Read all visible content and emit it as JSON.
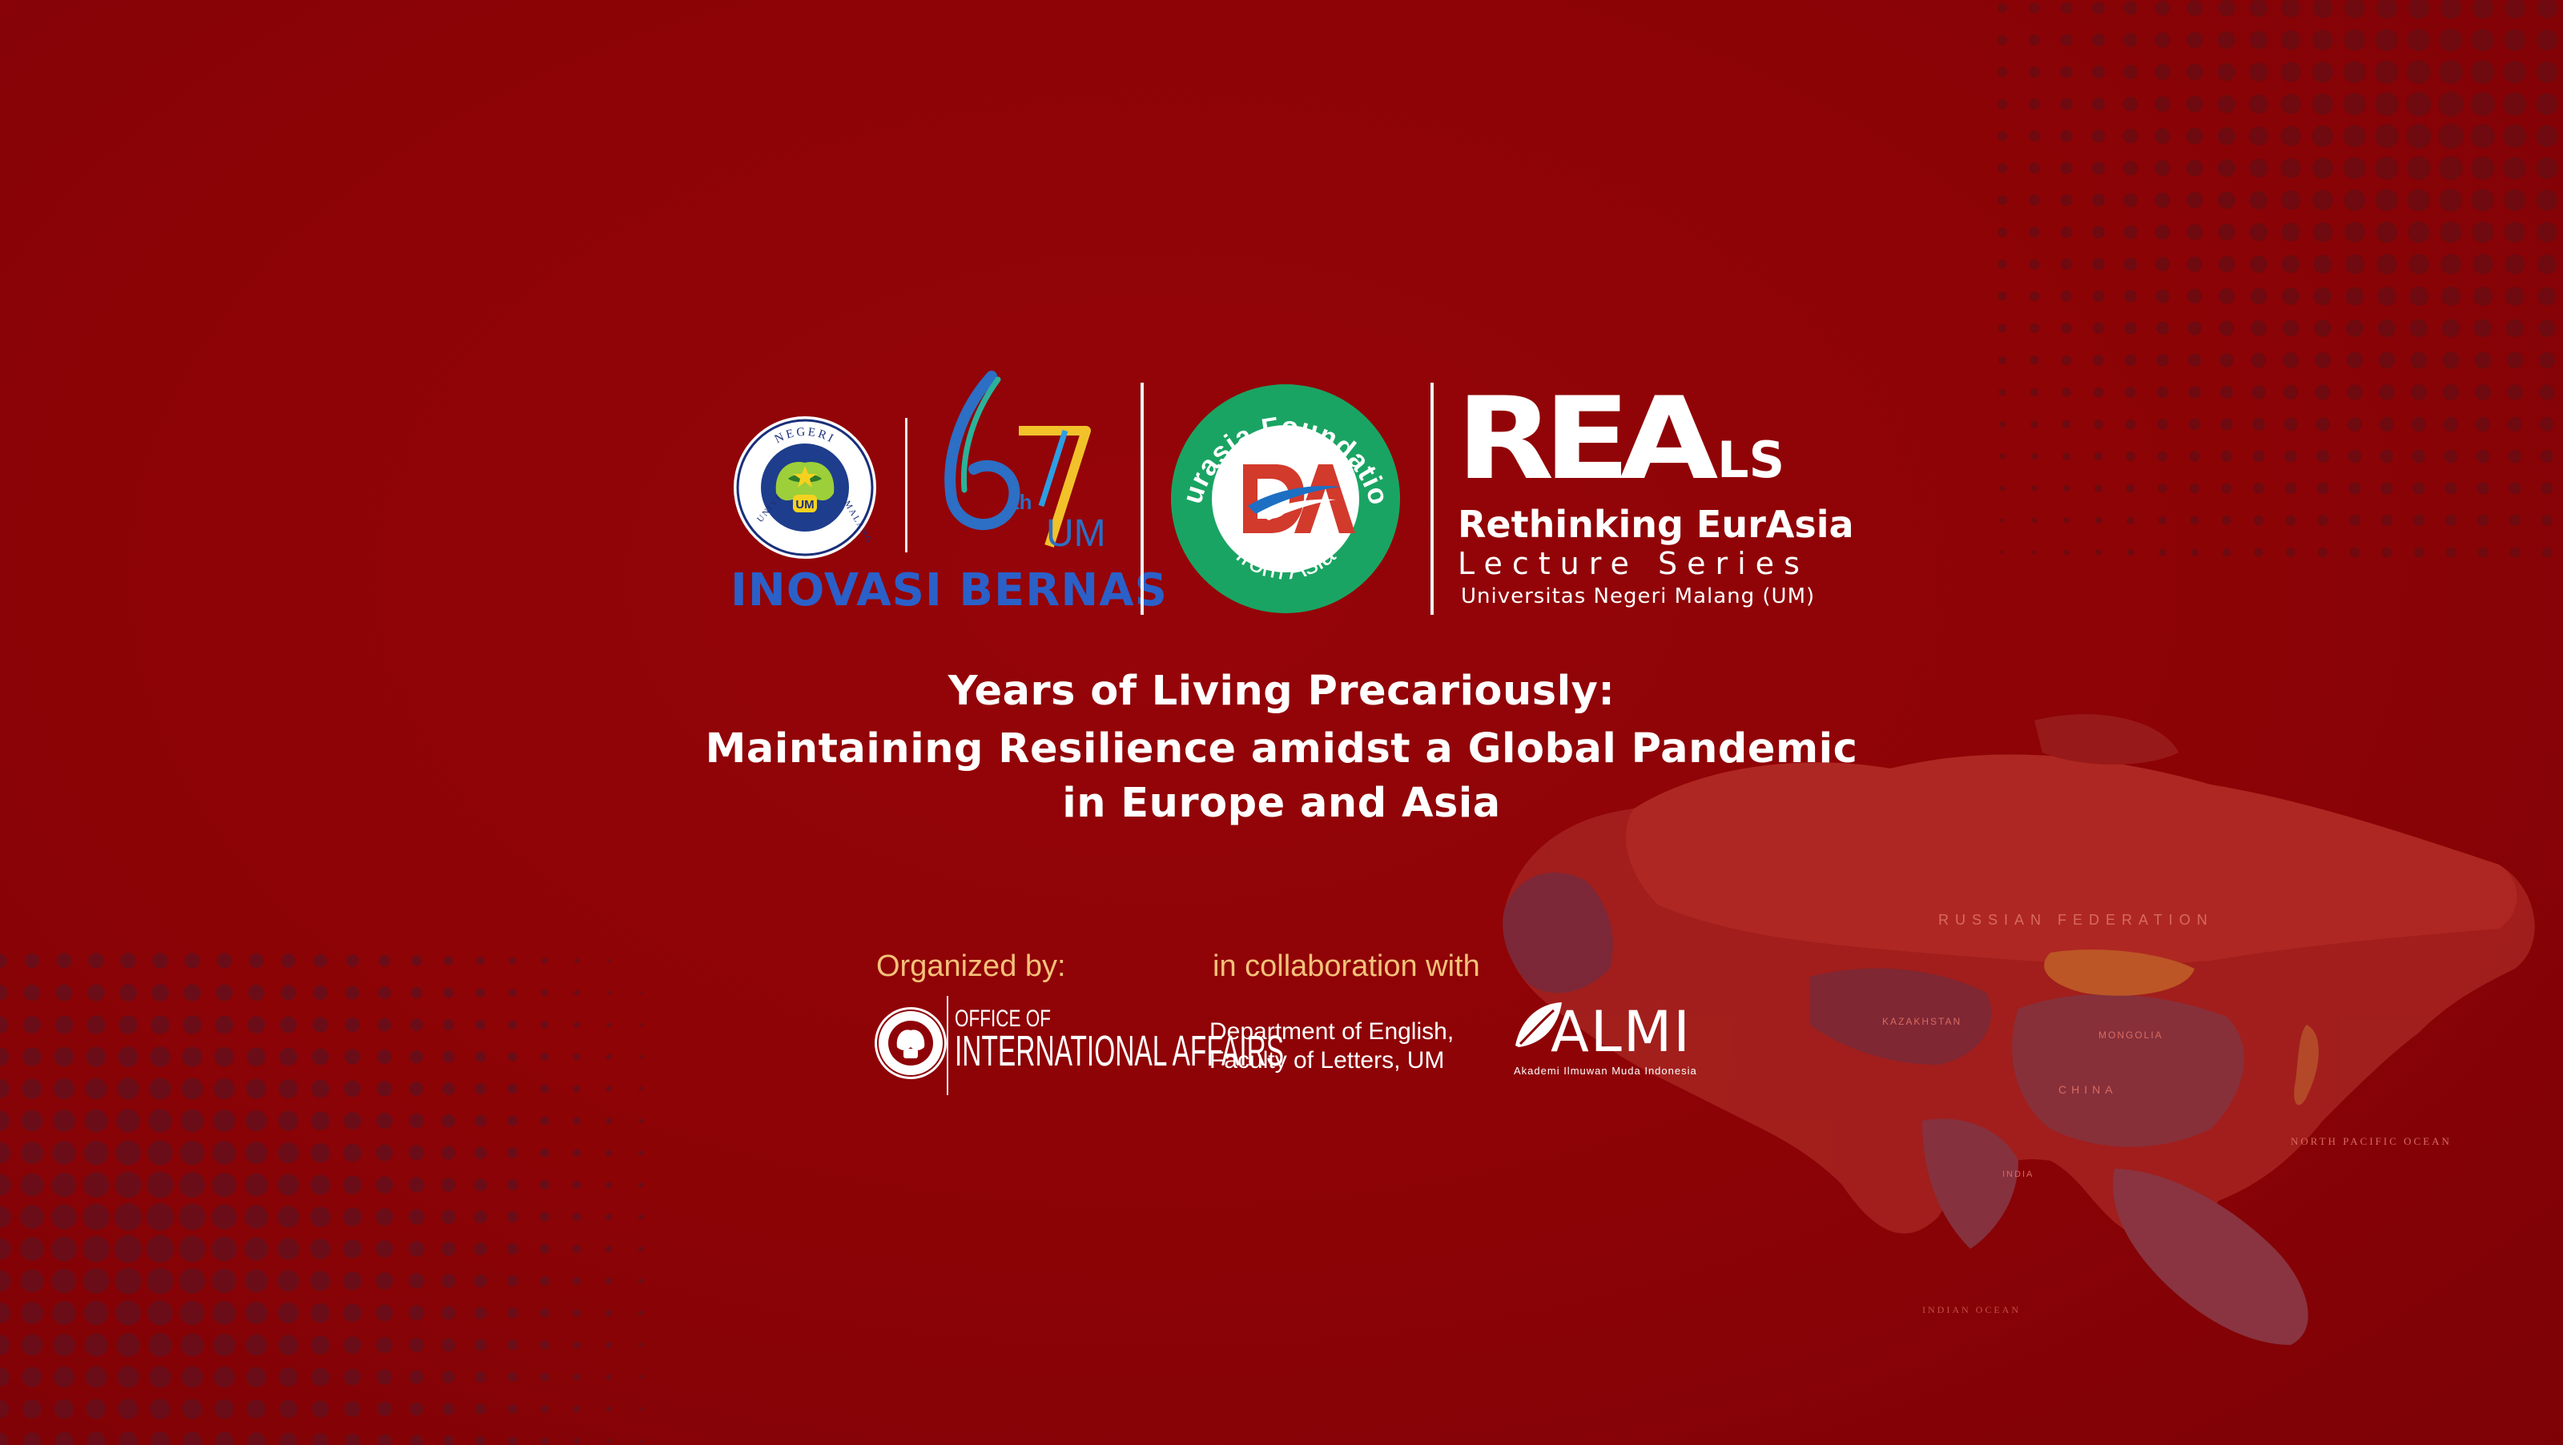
{
  "logos": {
    "um_seal_ring_top": "NEGERI",
    "um_seal_ring_left": "UNIVERSITAS",
    "um_seal_ring_right": "MALANG",
    "um_seal_center": "UM",
    "anniversary_number": "67",
    "anniversary_suffix": "th",
    "anniversary_um": "UM",
    "inovasi": "INOVASI BERNAS",
    "eurasia_ring_top": "Eurasia Foundation",
    "eurasia_ring_bottom": "from Asia",
    "eurasia_mark": "EA",
    "reals_main": "REA",
    "reals_small": "LS",
    "reals_line1": "Rethinking EurAsia",
    "reals_line2": "Lecture Series",
    "reals_line3": "Universitas Negeri Malang (UM)"
  },
  "title": {
    "line1": "Years of Living Precariously:",
    "line2": "Maintaining Resilience amidst a Global Pandemic",
    "line3": "in Europe and Asia"
  },
  "organizers": {
    "organized_label": "Organized by:",
    "collab_label": "in collaboration with",
    "oia_line1": "OFFICE OF",
    "oia_line2": "INTERNATIONAL AFFAIRS",
    "dept_line1": "Department of English,",
    "dept_line2": "Faculty of Letters, UM",
    "almi_name": "ALMI",
    "almi_sub": "Akademi Ilmuwan Muda Indonesia"
  },
  "map": {
    "russia": "RUSSIAN FEDERATION",
    "kazakhstan": "KAZAKHSTAN",
    "mongolia": "MONGOLIA",
    "china": "CHINA",
    "india": "INDIA",
    "pacific": "NORTH PACIFIC OCEAN",
    "indian_ocean": "INDIAN OCEAN"
  },
  "colors": {
    "background": "#8e0307",
    "inovasi_blue": "#2b60c8",
    "eurasia_green": "#1aa463",
    "organizer_label": "#f4c27a"
  }
}
